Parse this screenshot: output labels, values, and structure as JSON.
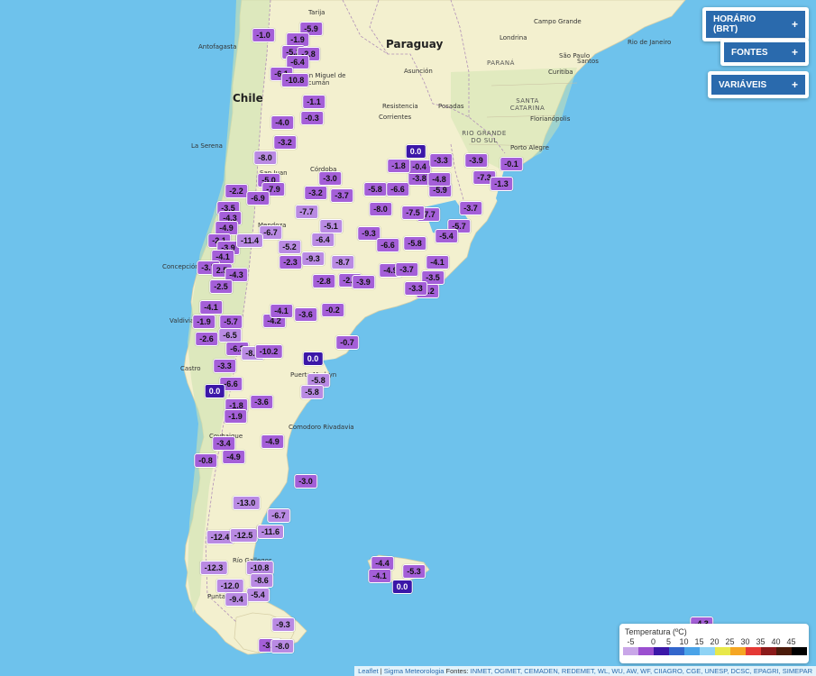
{
  "controls": {
    "horario": "HORÁRIO (BRT)",
    "fontes": "FONTES",
    "variaveis": "VARIÁVEIS",
    "plus": "+"
  },
  "legend": {
    "title": "Temperatura (ºC)",
    "scale": [
      {
        "label": "-5",
        "color": "#c9a6e8"
      },
      {
        "label": "0",
        "color": "#9b4fd0"
      },
      {
        "label": "5",
        "color": "#3b17a8"
      },
      {
        "label": "10",
        "color": "#3366cc"
      },
      {
        "label": "15",
        "color": "#4aa3e8"
      },
      {
        "label": "20",
        "color": "#8fd3f5"
      },
      {
        "label": "25",
        "color": "#e8e84a"
      },
      {
        "label": "30",
        "color": "#f5a623"
      },
      {
        "label": "35",
        "color": "#e53935"
      },
      {
        "label": "40",
        "color": "#8b1a1a"
      },
      {
        "label": "45",
        "color": "#4a1a0a"
      },
      {
        "label": "",
        "color": "#000000"
      }
    ]
  },
  "attribution": {
    "leaflet": "Leaflet",
    "sep": " | ",
    "brand": "Sigma Meteorologia",
    "fontes_label": " Fontes: ",
    "sources": "INMET, OGIMET, CEMADEN, REDEMET, WL, WU, AW, WF, CIIAGRO, CGE, UNESP, DCSC, EPAGRI, SIMEPAR"
  },
  "map": {
    "countries": [
      {
        "name": "Chile"
      },
      {
        "name": "Paraguay"
      }
    ],
    "cities": [
      "Tarija",
      "Antofagasta",
      "San Miguel de Tucumán",
      "La Serena",
      "Córdoba",
      "San Juan",
      "Mendoza",
      "Concepción",
      "Valdivia",
      "Castro",
      "Coyhaique",
      "Comodoro Rivadavia",
      "Puerto Madryn",
      "Río Gallegos",
      "Punta Arenas",
      "Asunción",
      "Resistencia",
      "Posadas",
      "Corrientes",
      "Porto Alegre",
      "Curitiba",
      "São Paulo",
      "Rio de Janeiro",
      "Campo Grande",
      "Londrina",
      "Santos",
      "Florianópolis"
    ],
    "states": [
      "PARANÁ",
      "SANTA CATARINA",
      "RIO GRANDE DO SUL"
    ]
  },
  "stations": [
    "-1.0",
    "-5.9",
    "-1.9",
    "-5.2",
    "-2.8",
    "-6.4",
    "-6.1",
    "-10.8",
    "-1.1",
    "-0.3",
    "-4.0",
    "-3.2",
    "-8.0",
    "-5.0",
    "-7.9",
    "-2.2",
    "-6.9",
    "-3.5",
    "-4.3",
    "-4.9",
    "-6.7",
    "-2.1",
    "-3.9",
    "-11.4",
    "-4.1",
    "-3.7",
    "2.5",
    "-4.3",
    "-5.2",
    "-2.3",
    "-2.5",
    "-4.1",
    "-1.9",
    "-5.7",
    "-6.5",
    "-2.6",
    "-6.3",
    "-3.3",
    "-8.2",
    "-10.2",
    "-6.6",
    "0.0",
    "-1.8",
    "-1.9",
    "-3.6",
    "-5.8",
    "-5.8",
    "-3.4",
    "-4.9",
    "-0.8",
    "-4.9",
    "-3.0",
    "-13.0",
    "-6.7",
    "-12.4",
    "-12.5",
    "-11.6",
    "-12.3",
    "-10.8",
    "-8.6",
    "-12.0",
    "-5.4",
    "-9.4",
    "-9.3",
    "-3.7",
    "-8.0",
    "-0.7",
    "-4.2",
    "-3.6",
    "-0.2",
    "-4.1",
    "-3.0",
    "-9.3",
    "-8.7",
    "-2.8",
    "-6.4",
    "-5.1",
    "-7.7",
    "-3.2",
    "-3.7",
    "-5.8",
    "-6.6",
    "-8.0",
    "-9.3",
    "-6.6",
    "-5.8",
    "-7.7",
    "-7.5",
    "-5.9",
    "-3.8",
    "-4.8",
    "-0.4",
    "-1.8",
    "-3.3",
    "-3.9",
    "-0.1",
    "-7.3",
    "-1.3",
    "-3.7",
    "-5.7",
    "-5.4",
    "-2.2",
    "-4.9",
    "-3.5",
    "-4.1",
    "-3.3",
    "-2.8",
    "-3.9",
    "-3.7",
    "0.0",
    "-4.4",
    "-5.3",
    "-4.1",
    "0.0",
    "-4.3",
    "0.0"
  ]
}
